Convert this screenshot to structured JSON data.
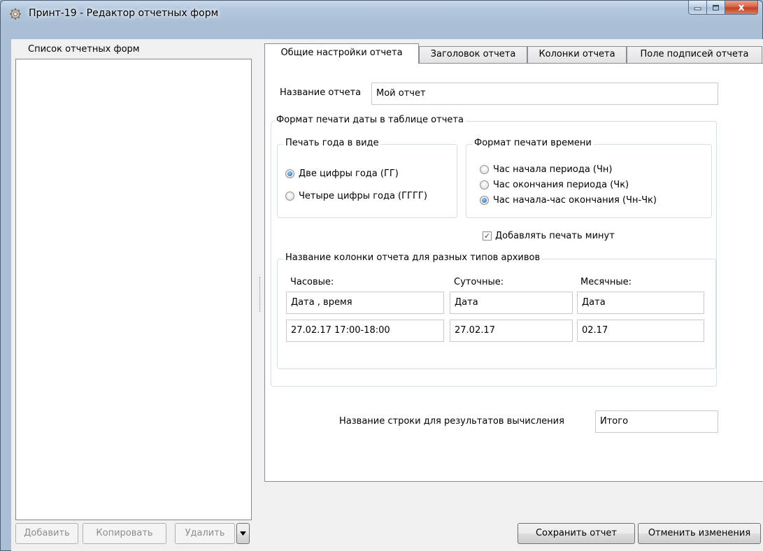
{
  "window": {
    "title": "Принт-19 - Редактор отчетных форм",
    "close_glyph": "x"
  },
  "left": {
    "caption": "Список отчетных форм",
    "buttons": {
      "add": "Добавить",
      "copy": "Копировать",
      "delete": "Удалить"
    }
  },
  "tabs": [
    {
      "label": "Общие настройки отчета",
      "active": true
    },
    {
      "label": "Заголовок отчета",
      "active": false
    },
    {
      "label": "Колонки отчета",
      "active": false
    },
    {
      "label": "Поле подписей отчета",
      "active": false
    }
  ],
  "general": {
    "report_name_label": "Название отчета",
    "report_name_value": "Мой отчет",
    "date_format_group": "Формат печати даты в таблице отчета",
    "year_group": {
      "caption": "Печать года в виде",
      "options": [
        {
          "label": "Две цифры  года (ГГ)",
          "checked": true
        },
        {
          "label": "Четыре цифры года (ГГГГ)",
          "checked": false
        }
      ]
    },
    "time_group": {
      "caption": "Формат печати времени",
      "options": [
        {
          "label": "Час начала периода (Чн)",
          "checked": false
        },
        {
          "label": "Час окончания периода (Чк)",
          "checked": false
        },
        {
          "label": "Час начала-час окончания (Чн-Чк)",
          "checked": true
        }
      ]
    },
    "add_minutes": {
      "label": "Добавлять печать минут",
      "checked": true,
      "mark": "✓"
    },
    "column_names_group": {
      "caption": "Название колонки отчета для разных типов архивов",
      "hourly": {
        "label": "Часовые:",
        "name": "Дата , время",
        "sample": "27.02.17 17:00-18:00"
      },
      "daily": {
        "label": "Суточные:",
        "name": "Дата",
        "sample": "27.02.17"
      },
      "monthly": {
        "label": "Месячные:",
        "name": "Дата",
        "sample": "02.17"
      }
    },
    "total_row_label": "Название строки для результатов вычисления",
    "total_row_value": "Итого"
  },
  "bottom_buttons": {
    "save": "Сохранить отчет",
    "cancel": "Отменить изменения"
  }
}
